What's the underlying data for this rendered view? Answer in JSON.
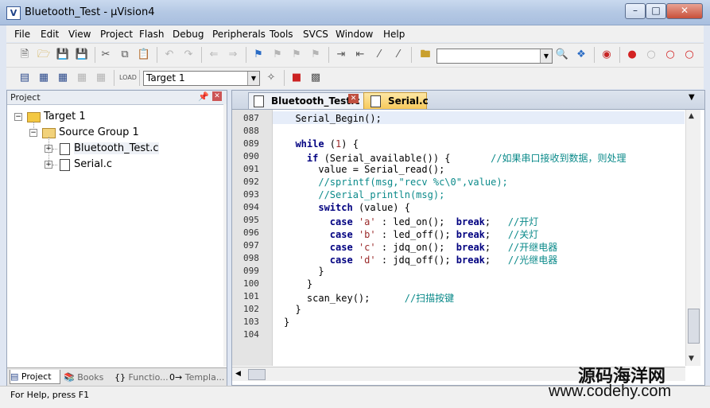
{
  "window": {
    "title": "Bluetooth_Test - μVision4"
  },
  "menu": [
    "File",
    "Edit",
    "View",
    "Project",
    "Flash",
    "Debug",
    "Peripherals",
    "Tools",
    "SVCS",
    "Window",
    "Help"
  ],
  "toolbar": {
    "target_select": "Target 1",
    "search_value": ""
  },
  "project_panel": {
    "title": "Project",
    "tree": {
      "target": "Target 1",
      "group": "Source Group 1",
      "files": [
        "Bluetooth_Test.c",
        "Serial.c"
      ]
    },
    "tabs": [
      "Project",
      "Books",
      "Functio...",
      "Templa..."
    ]
  },
  "editor": {
    "tabs": [
      "Bluetooth_Test.c",
      "Serial.c"
    ],
    "lines": [
      {
        "no": "087",
        "text": "  Serial_Begin();"
      },
      {
        "no": "088",
        "text": ""
      },
      {
        "no": "089",
        "text": "  while (1) {"
      },
      {
        "no": "090",
        "text": "    if (Serial_available()) {       //如果串口接收到数据，则处理"
      },
      {
        "no": "091",
        "text": "      value = Serial_read();"
      },
      {
        "no": "092",
        "text": "      //sprintf(msg,\"recv %c\\0\",value);"
      },
      {
        "no": "093",
        "text": "      //Serial_println(msg);"
      },
      {
        "no": "094",
        "text": "      switch (value) {"
      },
      {
        "no": "095",
        "text": "        case 'a' : led_on();  break;   //开灯"
      },
      {
        "no": "096",
        "text": "        case 'b' : led_off(); break;   //关灯"
      },
      {
        "no": "097",
        "text": "        case 'c' : jdq_on();  break;   //开继电器"
      },
      {
        "no": "098",
        "text": "        case 'd' : jdq_off(); break;   //光继电器"
      },
      {
        "no": "099",
        "text": "      }"
      },
      {
        "no": "100",
        "text": "    }"
      },
      {
        "no": "101",
        "text": "    scan_key();      //扫描按键"
      },
      {
        "no": "102",
        "text": "  }"
      },
      {
        "no": "103",
        "text": "}"
      },
      {
        "no": "104",
        "text": ""
      }
    ]
  },
  "status": {
    "help": "For Help, press F1"
  },
  "watermark": {
    "line1": "源码海洋网",
    "line2": "www.codehy.com"
  }
}
